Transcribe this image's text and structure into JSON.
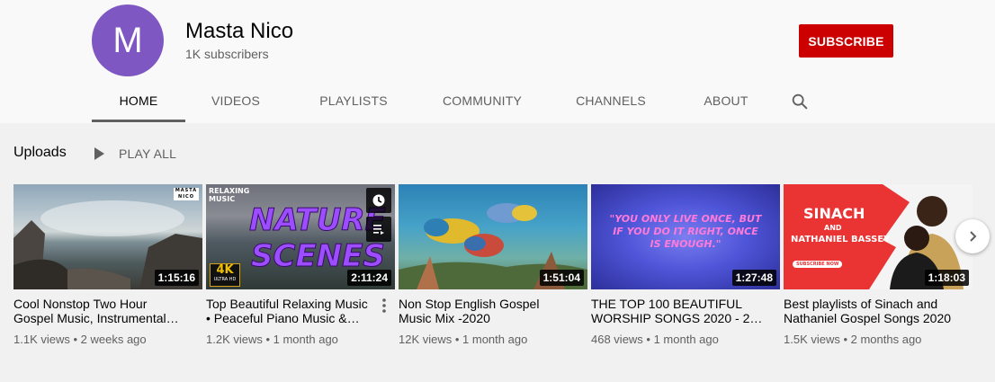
{
  "channel": {
    "avatar_letter": "M",
    "name": "Masta Nico",
    "subscribers": "1K subscribers",
    "subscribe_label": "SUBSCRIBE",
    "avatar_color": "#7e57c2",
    "accent_color": "#cc0000"
  },
  "tabs": [
    {
      "label": "HOME",
      "active": true
    },
    {
      "label": "VIDEOS"
    },
    {
      "label": "PLAYLISTS"
    },
    {
      "label": "COMMUNITY"
    },
    {
      "label": "CHANNELS"
    },
    {
      "label": "ABOUT"
    }
  ],
  "search_icon": "search-icon",
  "section": {
    "title": "Uploads",
    "play_all": "PLAY ALL"
  },
  "videos": [
    {
      "title_line1": "Cool Nonstop Two Hour",
      "title_line2": "Gospel Music, Instrumental…",
      "meta": "1.1K views • 2 weeks ago",
      "duration": "1:15:16",
      "badge": "MASTA NICO"
    },
    {
      "title_line1": "Top Beautiful Relaxing Music",
      "title_line2": "• Peaceful Piano Music &…",
      "meta": "1.2K views • 1 month ago",
      "duration": "2:11:24",
      "overlay_top": "RELAXING MUSIC",
      "overlay_main1": "NATURE",
      "overlay_main2": "SCENES",
      "badge_4k": "4K",
      "badge_uhd": "ULTRA HD"
    },
    {
      "title_line1": "Non Stop English Gospel",
      "title_line2": "Music Mix -2020",
      "meta": "12K views • 1 month ago",
      "duration": "1:51:04"
    },
    {
      "title_line1": "THE TOP 100 BEAUTIFUL",
      "title_line2": "WORSHIP SONGS 2020 - 2…",
      "meta": "468 views • 1 month ago",
      "duration": "1:27:48",
      "quote1": "\"YOU ONLY LIVE ONCE, BUT",
      "quote2": "IF YOU DO IT RIGHT, ONCE",
      "quote3": "IS ENOUGH.\""
    },
    {
      "title_line1": "Best playlists of Sinach and",
      "title_line2": "Nathaniel Gospel Songs 2020",
      "meta": "1.5K views • 2 months ago",
      "duration": "1:18:03",
      "overlay1": "SINACH",
      "overlay2": "AND",
      "overlay3": "NATHANIEL BASSEY",
      "overlay_button": "SUBSCRIBE NOW"
    }
  ]
}
